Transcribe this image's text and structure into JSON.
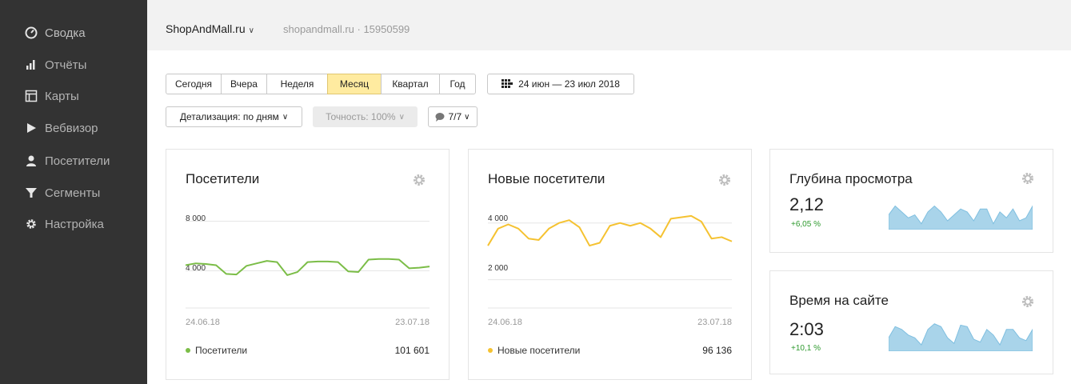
{
  "colors": {
    "sidebar_bg": "#333333",
    "accent_active": "#ffeba0",
    "green_series": "#7bbd47",
    "yellow_series": "#f5c231",
    "spark_fill": "#a9d4ea",
    "positive": "#2e9a2e"
  },
  "sidebar": {
    "items": [
      {
        "label": "Сводка",
        "icon": "dashboard-gauge-icon"
      },
      {
        "label": "Отчёты",
        "icon": "bar-chart-icon"
      },
      {
        "label": "Карты",
        "icon": "map-layout-icon"
      },
      {
        "label": "Вебвизор",
        "icon": "play-icon"
      },
      {
        "label": "Посетители",
        "icon": "person-icon"
      },
      {
        "label": "Сегменты",
        "icon": "filter-funnel-icon"
      },
      {
        "label": "Настройка",
        "icon": "gear-icon"
      }
    ]
  },
  "header": {
    "site_name": "ShopAndMall.ru",
    "site_sub": "shopandmall.ru · 15950599"
  },
  "period": {
    "tabs": [
      "Сегодня",
      "Вчера",
      "Неделя",
      "Месяц",
      "Квартал",
      "Год"
    ],
    "active_tab": "Месяц",
    "date_range": "24 июн — 23 июл 2018"
  },
  "filters": {
    "detail": "Детализация: по дням",
    "accuracy": "Точность: 100%",
    "attribution": "7/7"
  },
  "cards": {
    "visitors": {
      "title": "Посетители",
      "y_ticks": [
        "8 000",
        "4 000"
      ],
      "date_start": "24.06.18",
      "date_end": "23.07.18",
      "legend": "Посетители",
      "total": "101 601"
    },
    "new_visitors": {
      "title": "Новые посетители",
      "y_ticks": [
        "4 000",
        "2 000"
      ],
      "date_start": "24.06.18",
      "date_end": "23.07.18",
      "legend": "Новые посетители",
      "total": "96 136"
    },
    "depth": {
      "title": "Глубина просмотра",
      "value": "2,12",
      "delta": "+6,05 %"
    },
    "time": {
      "title": "Время на сайте",
      "value": "2:03",
      "delta": "+10,1 %"
    }
  },
  "chart_data": [
    {
      "type": "line",
      "series": [
        {
          "name": "Посетители",
          "values": [
            4450,
            4600,
            4550,
            4450,
            3750,
            3700,
            4400,
            4600,
            4800,
            4700,
            3650,
            3900,
            4700,
            4750,
            4750,
            4700,
            3950,
            3900,
            4900,
            4950,
            4950,
            4900,
            4200,
            4250,
            4350
          ]
        }
      ],
      "ylim": [
        1000,
        9000
      ],
      "y_ticks": [
        4000,
        8000
      ],
      "x_labels": [
        "24.06.18",
        "23.07.18"
      ]
    },
    {
      "type": "line",
      "series": [
        {
          "name": "Новые посетители",
          "values": [
            3200,
            3800,
            3950,
            3800,
            3450,
            3400,
            3800,
            4000,
            4100,
            3850,
            3200,
            3300,
            3900,
            4000,
            3900,
            4000,
            3800,
            3500,
            4150,
            4200,
            4250,
            4050,
            3450,
            3500,
            3350
          ]
        }
      ],
      "ylim": [
        1000,
        4500
      ],
      "y_ticks": [
        2000,
        4000
      ],
      "x_labels": [
        "24.06.18",
        "23.07.18"
      ]
    },
    {
      "type": "area",
      "values": [
        2.15,
        2.3,
        2.2,
        2.1,
        2.15,
        2.0,
        2.2,
        2.3,
        2.2,
        2.05,
        2.15,
        2.25,
        2.2,
        2.05,
        2.25,
        2.25,
        2.0,
        2.2,
        2.1,
        2.25,
        2.05,
        2.1,
        2.3
      ]
    },
    {
      "type": "area",
      "values": [
        2.0,
        2.4,
        2.3,
        2.1,
        2.0,
        1.75,
        2.3,
        2.5,
        2.4,
        2.0,
        1.8,
        2.45,
        2.4,
        1.95,
        1.85,
        2.3,
        2.1,
        1.75,
        2.3,
        2.3,
        2.0,
        1.9,
        2.3
      ]
    }
  ]
}
